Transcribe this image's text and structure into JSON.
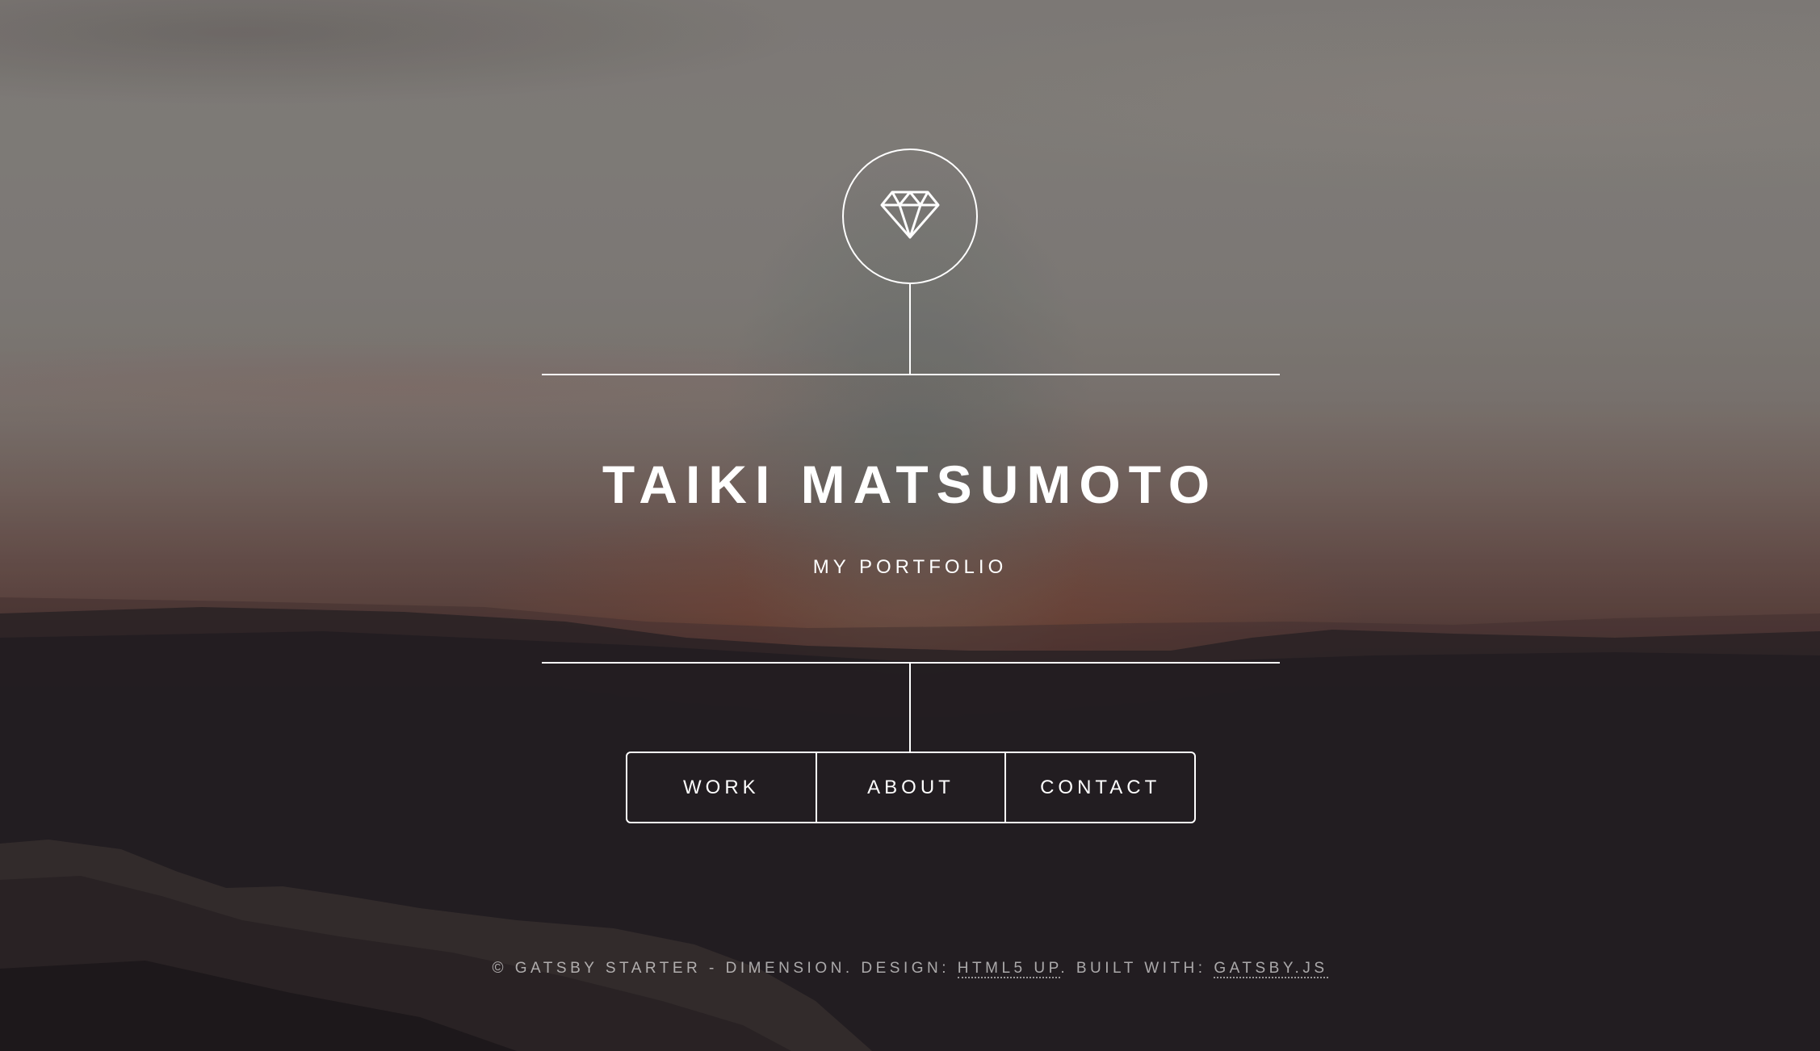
{
  "header": {
    "logo_icon": "diamond-icon",
    "title": "TAIKI MATSUMOTO",
    "subtitle": "MY PORTFOLIO"
  },
  "nav": {
    "items": [
      {
        "label": "WORK"
      },
      {
        "label": "ABOUT"
      },
      {
        "label": "CONTACT"
      }
    ]
  },
  "footer": {
    "prefix": "© GATSBY STARTER - DIMENSION. DESIGN: ",
    "design_link": "HTML5 UP",
    "middle": ". BUILT WITH: ",
    "built_link": "GATSBY.JS"
  },
  "colors": {
    "foreground": "#ffffff",
    "background_dark": "#231e22",
    "sky": "#8b8783"
  }
}
